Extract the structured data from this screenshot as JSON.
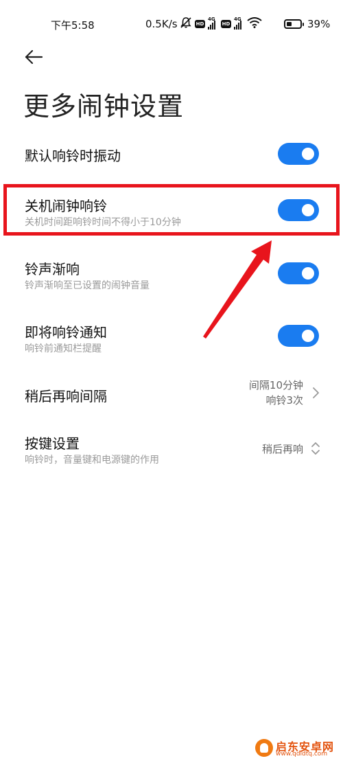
{
  "status_bar": {
    "time": "下午5:58",
    "net_speed": "0.5K/s",
    "hd_label": "HD",
    "network_label": "4G",
    "battery_pct": "39%",
    "battery_level": 0.39
  },
  "header": {
    "back_icon": "arrow-left-icon",
    "title": "更多闹钟设置"
  },
  "settings": [
    {
      "label": "默认响铃时振动",
      "sub": "",
      "control": "toggle",
      "on": true
    },
    {
      "label": "关机闹钟响铃",
      "sub": "关机时间距响铃时间不得小于10分钟",
      "control": "toggle",
      "on": true,
      "highlighted": true
    },
    {
      "label": "铃声渐响",
      "sub": "铃声渐响至已设置的闹钟音量",
      "control": "toggle",
      "on": true
    },
    {
      "label": "即将响铃通知",
      "sub": "响铃前通知栏提醒",
      "control": "toggle",
      "on": true
    },
    {
      "label": "稍后再响间隔",
      "sub": "",
      "control": "value",
      "value_line1": "间隔10分钟",
      "value_line2": "响铃3次",
      "icon": "chevron-right-icon"
    },
    {
      "label": "按键设置",
      "sub": "响铃时，音量键和电源键的作用",
      "control": "select",
      "value_line1": "稍后再响",
      "icon": "chevron-up-down-icon"
    }
  ],
  "annotation": {
    "frame_color": "#e8141c",
    "arrow_color": "#e8141c"
  },
  "watermark": {
    "name": "启东安卓网",
    "url": "www.qdldtq.com"
  },
  "colors": {
    "accent": "#1a7cf0"
  }
}
